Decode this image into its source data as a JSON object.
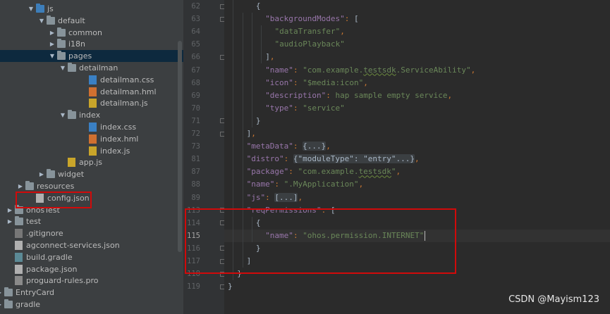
{
  "tree": [
    {
      "label": "js",
      "depth": 3,
      "icon": "folder",
      "open": true,
      "blue": true
    },
    {
      "label": "default",
      "depth": 4,
      "icon": "folder",
      "open": true
    },
    {
      "label": "common",
      "depth": 5,
      "icon": "folder",
      "open": false
    },
    {
      "label": "i18n",
      "depth": 5,
      "icon": "folder",
      "open": false
    },
    {
      "label": "pages",
      "depth": 5,
      "icon": "folder",
      "open": true,
      "selected": true
    },
    {
      "label": "detailman",
      "depth": 6,
      "icon": "folder",
      "open": true
    },
    {
      "label": "detailman.css",
      "depth": 8,
      "icon": "css"
    },
    {
      "label": "detailman.hml",
      "depth": 8,
      "icon": "html"
    },
    {
      "label": "detailman.js",
      "depth": 8,
      "icon": "js"
    },
    {
      "label": "index",
      "depth": 6,
      "icon": "folder",
      "open": true
    },
    {
      "label": "index.css",
      "depth": 8,
      "icon": "css"
    },
    {
      "label": "index.hml",
      "depth": 8,
      "icon": "html"
    },
    {
      "label": "index.js",
      "depth": 8,
      "icon": "js"
    },
    {
      "label": "app.js",
      "depth": 6,
      "icon": "js"
    },
    {
      "label": "widget",
      "depth": 4,
      "icon": "folder",
      "open": false
    },
    {
      "label": "resources",
      "depth": 2,
      "icon": "folder",
      "open": false
    },
    {
      "label": "config.json",
      "depth": 3,
      "icon": "json"
    },
    {
      "label": "ohosTest",
      "depth": 1,
      "icon": "folder",
      "open": false
    },
    {
      "label": "test",
      "depth": 1,
      "icon": "folder",
      "open": false
    },
    {
      "label": ".gitignore",
      "depth": 1,
      "icon": "git"
    },
    {
      "label": "agconnect-services.json",
      "depth": 1,
      "icon": "json"
    },
    {
      "label": "build.gradle",
      "depth": 1,
      "icon": "gradle"
    },
    {
      "label": "package.json",
      "depth": 1,
      "icon": "json"
    },
    {
      "label": "proguard-rules.pro",
      "depth": 1,
      "icon": "pro"
    },
    {
      "label": "EntryCard",
      "depth": 0,
      "icon": "folder",
      "open": false
    },
    {
      "label": "gradle",
      "depth": 0,
      "icon": "folder",
      "open": false
    }
  ],
  "code_lines": [
    {
      "num": "62",
      "indent": 3,
      "tokens": [
        [
          "b",
          "{"
        ]
      ]
    },
    {
      "num": "63",
      "indent": 4,
      "tokens": [
        [
          "k",
          "\"backgroundModes\""
        ],
        [
          "p",
          ": "
        ],
        [
          "b",
          "["
        ]
      ]
    },
    {
      "num": "64",
      "indent": 5,
      "tokens": [
        [
          "s",
          "\"dataTransfer\""
        ],
        [
          "p",
          ","
        ]
      ]
    },
    {
      "num": "65",
      "indent": 5,
      "tokens": [
        [
          "s",
          "\"audioPlayback\""
        ]
      ]
    },
    {
      "num": "66",
      "indent": 4,
      "tokens": [
        [
          "b",
          "]"
        ],
        [
          "p",
          ","
        ]
      ]
    },
    {
      "num": "67",
      "indent": 4,
      "tokens": [
        [
          "k",
          "\"name\""
        ],
        [
          "p",
          ": "
        ],
        [
          "s",
          "\"com.example."
        ],
        [
          "sq",
          "testsdk"
        ],
        [
          "s",
          ".ServiceAbility\""
        ],
        [
          "p",
          ","
        ]
      ]
    },
    {
      "num": "68",
      "indent": 4,
      "tokens": [
        [
          "k",
          "\"icon\""
        ],
        [
          "p",
          ": "
        ],
        [
          "s",
          "\"$media:icon\""
        ],
        [
          "p",
          ","
        ]
      ]
    },
    {
      "num": "69",
      "indent": 4,
      "tokens": [
        [
          "k",
          "\"description\""
        ],
        [
          "p",
          ": "
        ],
        [
          "s",
          "hap sample empty service"
        ],
        [
          "p",
          ","
        ]
      ]
    },
    {
      "num": "70",
      "indent": 4,
      "tokens": [
        [
          "k",
          "\"type\""
        ],
        [
          "p",
          ": "
        ],
        [
          "s",
          "\"service\""
        ]
      ]
    },
    {
      "num": "71",
      "indent": 3,
      "tokens": [
        [
          "b",
          "}"
        ]
      ]
    },
    {
      "num": "72",
      "indent": 2,
      "tokens": [
        [
          "b",
          "]"
        ],
        [
          "p",
          ","
        ]
      ]
    },
    {
      "num": "73",
      "indent": 2,
      "tokens": [
        [
          "k",
          "\"metaData\""
        ],
        [
          "p",
          ": "
        ],
        [
          "f",
          "{...}"
        ],
        [
          "p",
          ","
        ]
      ]
    },
    {
      "num": "81",
      "indent": 2,
      "tokens": [
        [
          "k",
          "\"distro\""
        ],
        [
          "p",
          ": "
        ],
        [
          "f",
          "{\"moduleType\": \"entry\"...}"
        ],
        [
          "p",
          ","
        ]
      ]
    },
    {
      "num": "87",
      "indent": 2,
      "tokens": [
        [
          "k",
          "\"package\""
        ],
        [
          "p",
          ": "
        ],
        [
          "s",
          "\"com.example."
        ],
        [
          "sq",
          "testsdk"
        ],
        [
          "s",
          "\""
        ],
        [
          "p",
          ","
        ]
      ]
    },
    {
      "num": "88",
      "indent": 2,
      "tokens": [
        [
          "k",
          "\"name\""
        ],
        [
          "p",
          ": "
        ],
        [
          "s",
          "\".MyApplication\""
        ],
        [
          "p",
          ","
        ]
      ]
    },
    {
      "num": "89",
      "indent": 2,
      "tokens": [
        [
          "k",
          "\"js\""
        ],
        [
          "p",
          ": "
        ],
        [
          "f",
          "[...]"
        ],
        [
          "p",
          ","
        ]
      ]
    },
    {
      "num": "113",
      "indent": 2,
      "tokens": [
        [
          "k",
          "\"reqPermissions\""
        ],
        [
          "p",
          ": "
        ],
        [
          "b",
          "["
        ]
      ]
    },
    {
      "num": "114",
      "indent": 3,
      "tokens": [
        [
          "b",
          "{"
        ]
      ]
    },
    {
      "num": "115",
      "indent": 4,
      "tokens": [
        [
          "k",
          "\"name\""
        ],
        [
          "p",
          ": "
        ],
        [
          "s",
          "\"ohos.permission.INTERNET\""
        ]
      ],
      "current": true
    },
    {
      "num": "116",
      "indent": 3,
      "tokens": [
        [
          "b",
          "}"
        ]
      ]
    },
    {
      "num": "117",
      "indent": 2,
      "tokens": [
        [
          "b",
          "]"
        ]
      ]
    },
    {
      "num": "118",
      "indent": 1,
      "tokens": [
        [
          "b",
          "}"
        ]
      ]
    },
    {
      "num": "119",
      "indent": 0,
      "tokens": [
        [
          "b",
          "}"
        ]
      ]
    }
  ],
  "watermark": "CSDN @Mayism123",
  "colors": {
    "highlight": "#d10a0a",
    "key": "#9876aa",
    "string": "#6a8759",
    "punct": "#cc7832"
  }
}
